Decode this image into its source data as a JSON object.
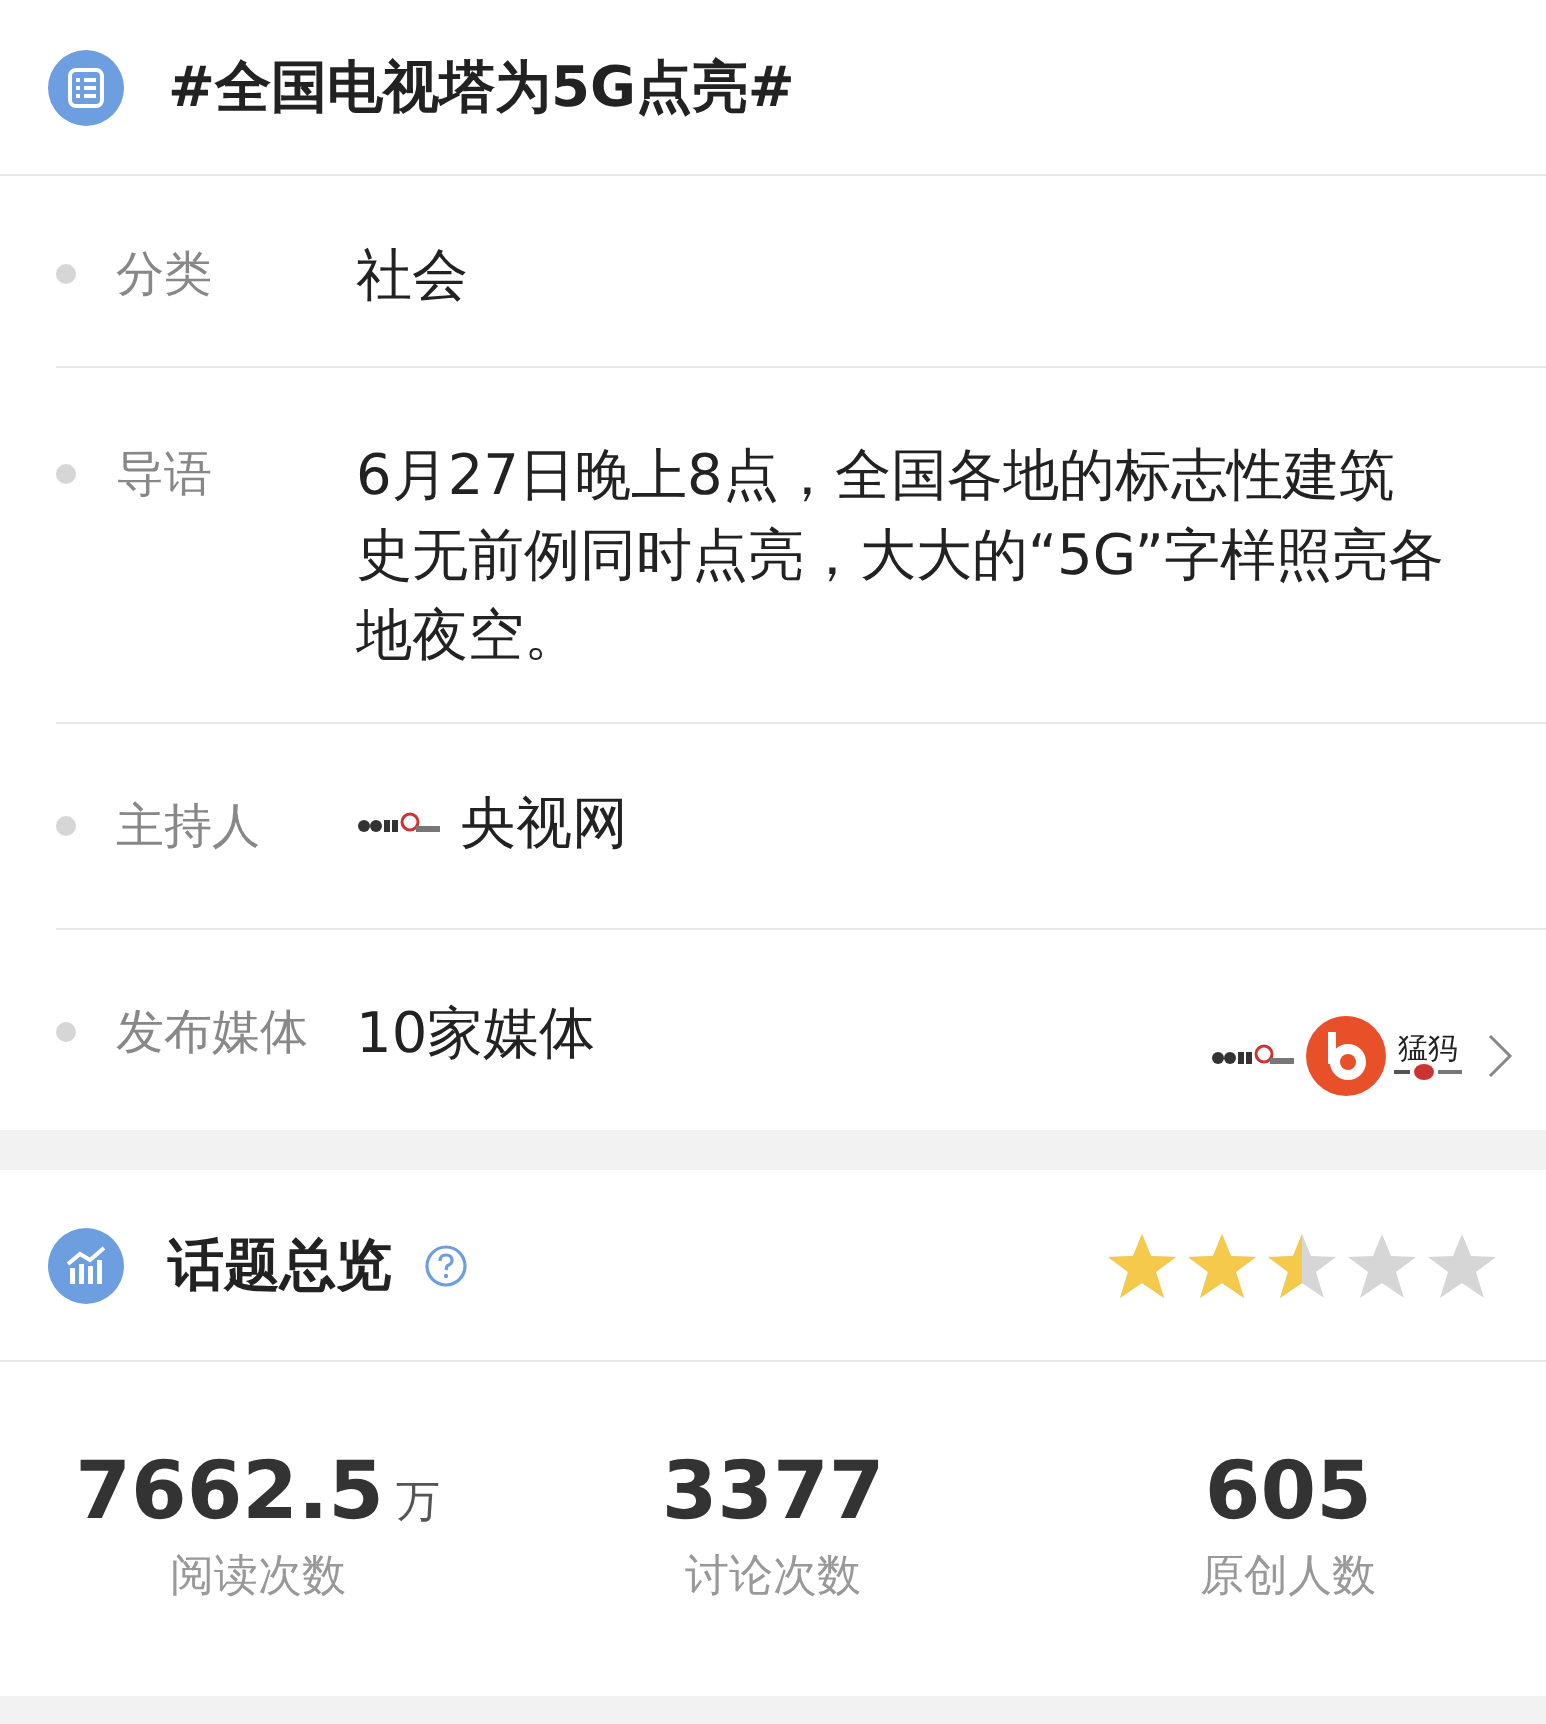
{
  "topic": {
    "title": "#全国电视塔为5G点亮#"
  },
  "fields": [
    {
      "kind": "text",
      "label": "分类",
      "value": "社会"
    },
    {
      "kind": "text",
      "label": "导语",
      "value": "6月27日晚上8点，全国各地的标志性建筑史无前例同时点亮，大大的“5G”字样照亮各地夜空。"
    },
    {
      "kind": "host",
      "label": "主持人",
      "value": "央视网"
    },
    {
      "kind": "media",
      "label": "发布媒体",
      "value": "10家媒体",
      "logo_text": "猛犸"
    }
  ],
  "overview": {
    "title": "话题总览",
    "stars": 2.5,
    "stats": [
      {
        "value": "7662.5",
        "unit": "万",
        "label": "阅读次数"
      },
      {
        "value": "3377",
        "label": "讨论次数"
      },
      {
        "value": "605",
        "label": "原创人数"
      }
    ]
  }
}
